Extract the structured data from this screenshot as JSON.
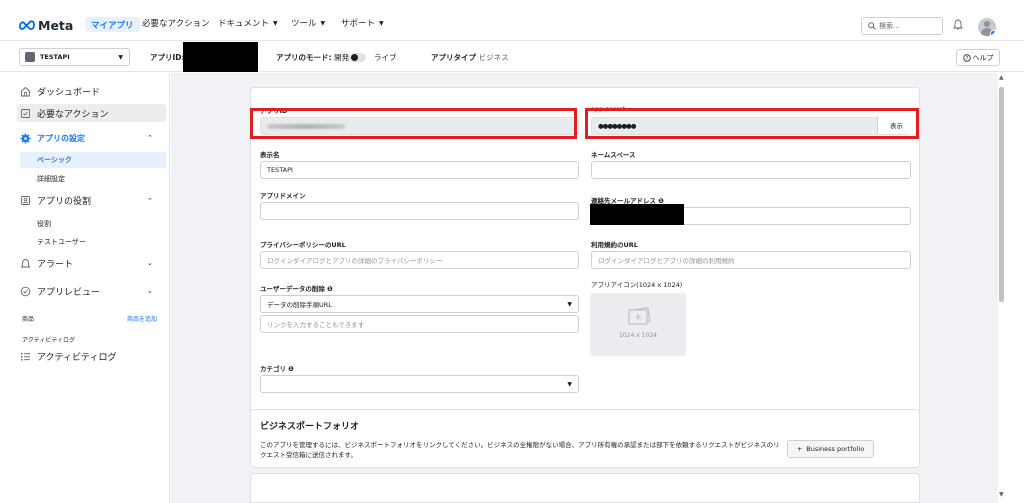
{
  "topnav": {
    "brand": "Meta",
    "items": [
      {
        "label": "マイアプリ",
        "active": true
      },
      {
        "label": "必要なアクション"
      },
      {
        "label": "ドキュメント"
      },
      {
        "label": "ツール"
      },
      {
        "label": "サポート"
      }
    ],
    "search_placeholder": "検索..."
  },
  "appbar": {
    "app_name": "TESTAPI",
    "app_id_label": "アプリID:",
    "mode_label": "アプリのモード:",
    "mode_dev": "開発",
    "mode_live": "ライブ",
    "type_label": "アプリタイプ",
    "type_value": "ビジネス",
    "help": "ヘルプ"
  },
  "sidebar": {
    "dashboard": "ダッシュボード",
    "required_actions": "必要なアクション",
    "app_settings": "アプリの設定",
    "basic": "ベーシック",
    "advanced": "詳細設定",
    "app_roles": "アプリの役割",
    "roles": "役割",
    "test_users": "テストユーザー",
    "alerts": "アラート",
    "app_review": "アプリレビュー",
    "products": "商品",
    "add_product": "商品を追加",
    "activity_log_small": "アクティビティログ",
    "activity_log": "アクティビティログ"
  },
  "form": {
    "app_id_label": "アプリID",
    "app_secret_label": "app secret",
    "app_secret_value": "●●●●●●●●",
    "show_button": "表示",
    "display_name_label": "表示名",
    "display_name_value": "TESTAPI",
    "namespace_label": "ネームスペース",
    "app_domain_label": "アプリドメイン",
    "contact_email_label": "連絡先メールアドレス",
    "privacy_label": "プライバシーポリシーのURL",
    "privacy_placeholder": "ログインダイアログとアプリの詳細のプライバシーポリシー",
    "terms_label": "利用規約のURL",
    "terms_placeholder": "ログインダイアログとアプリの詳細の利用規約",
    "data_deletion_label": "ユーザーデータの削除",
    "data_deletion_select": "データの削除手順URL",
    "data_deletion_placeholder": "リンクを入力することもできます",
    "app_icon_label": "アプリアイコン(1024 x 1024)",
    "app_icon_caption": "1024 x 1024",
    "category_label": "カテゴリ"
  },
  "business": {
    "title": "ビジネスポートフォリオ",
    "description": "このアプリを管理するには、ビジネスポートフォリオをリンクしてください。ビジネスの全権限がない場合、アプリ所有権の承認または部下を依頼するリクエストがビジネスのリクエスト受信箱に送信されます。",
    "button": "Business portfolio"
  },
  "colors": {
    "accent": "#1877f2",
    "highlight": "#e02020"
  }
}
